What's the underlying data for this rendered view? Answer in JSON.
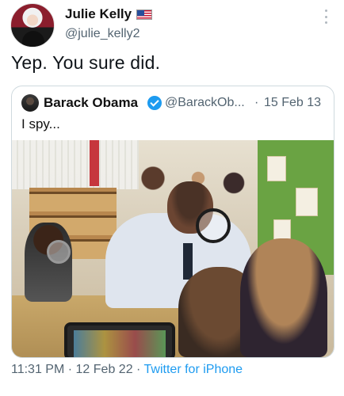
{
  "author": {
    "name": "Julie Kelly",
    "handle": "@julie_kelly2",
    "flag_icon": "us-flag-icon"
  },
  "tweet": {
    "text": "Yep. You sure did."
  },
  "quoted_tweet": {
    "name": "Barack Obama",
    "verified_icon": "verified-badge-icon",
    "verified_color": "#1d9bf0",
    "handle": "@BarackOb...",
    "separator": "·",
    "date": "15 Feb 13",
    "text": "I spy...",
    "photo_icon": "photo-image"
  },
  "footer": {
    "time": "11:31 PM",
    "separator": "·",
    "date": "12 Feb 22",
    "separator2": "·",
    "source": "Twitter for iPhone"
  },
  "colors": {
    "accent": "#1d9bf0",
    "muted_text": "#536471",
    "text": "#0f1419",
    "border": "#cfd9de"
  }
}
